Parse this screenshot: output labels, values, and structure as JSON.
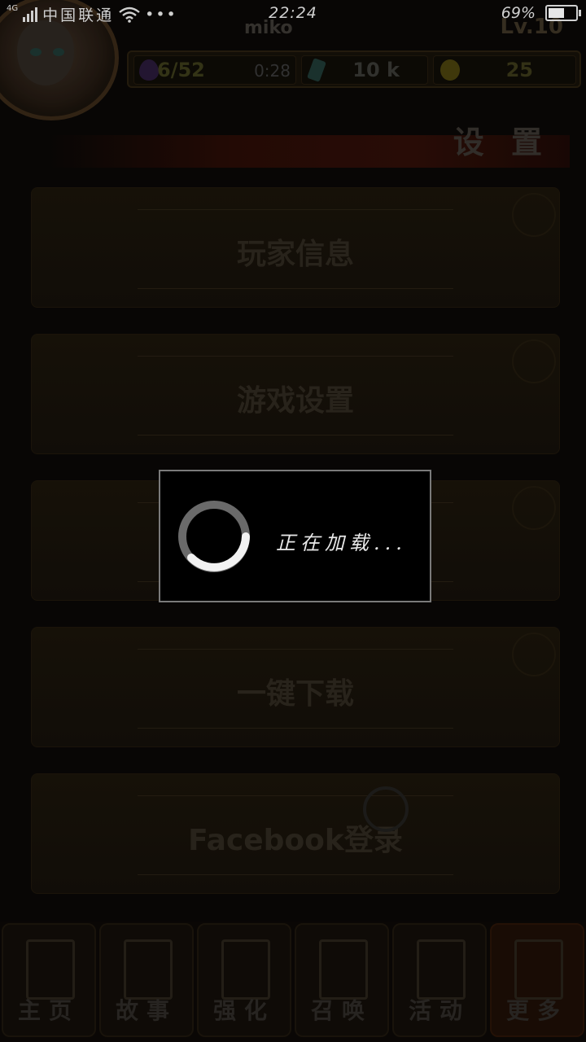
{
  "statusbar": {
    "network": "4G",
    "carrier": "中国联通",
    "more": "•••",
    "time": "22:24",
    "battery_text": "69%",
    "battery_level": 0.69
  },
  "header": {
    "player_name": "miko",
    "level": "Lv.10",
    "stamina": "6/52",
    "stamina_timer": "0:28",
    "gems": "10 k",
    "coins": "25"
  },
  "page": {
    "title": "设 置"
  },
  "menu": {
    "items": [
      {
        "label": "玩家信息"
      },
      {
        "label": "游戏设置"
      },
      {
        "label": ""
      },
      {
        "label": "一键下载"
      },
      {
        "label": "Facebook登录"
      }
    ]
  },
  "tabs": [
    {
      "label": "主页"
    },
    {
      "label": "故事"
    },
    {
      "label": "强化"
    },
    {
      "label": "召唤"
    },
    {
      "label": "活动"
    },
    {
      "label": "更多"
    }
  ],
  "loading": {
    "text": "正在加载..."
  },
  "colors": {
    "accent_tab": "#1e0f07",
    "dialog_border": "#7a7a7a"
  }
}
